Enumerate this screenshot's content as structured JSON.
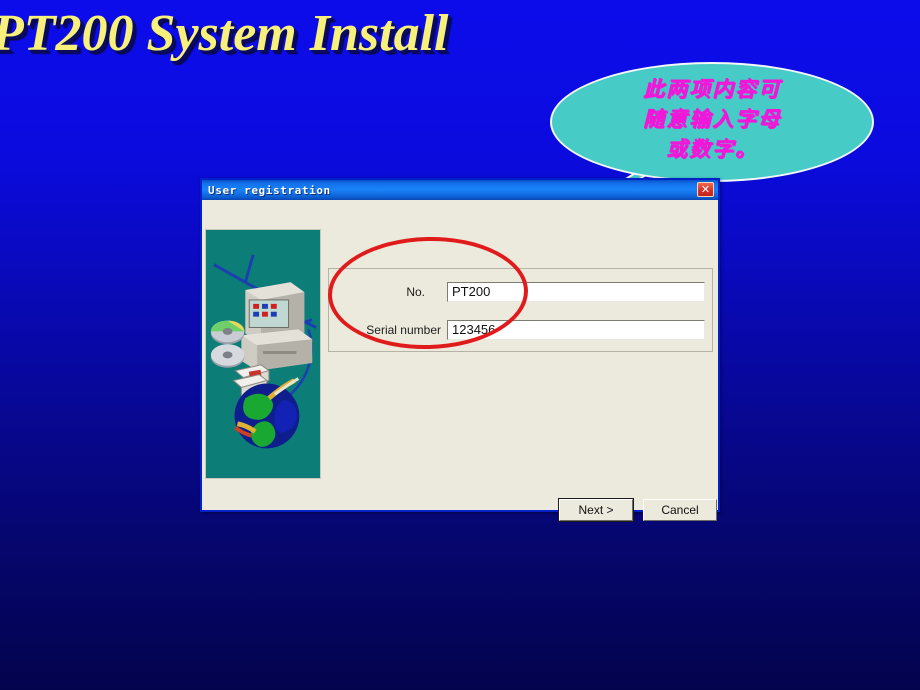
{
  "slide": {
    "title": "PT200 System Install",
    "background_top_color": "#0c0ceb",
    "background_bottom_color": "#03034d",
    "title_color": "#f7f07a"
  },
  "callout": {
    "fill_color": "#46cbc7",
    "text_color": "#f018d8",
    "lines": [
      "此两项内容可",
      "随意输入字母",
      "或数字。"
    ]
  },
  "annotation": {
    "ellipse_color": "#e01b1b"
  },
  "dialog": {
    "title": "User registration",
    "close_icon": "close-icon",
    "close_glyph": "✕",
    "side_graphic": "computer-network-globe-graphic",
    "fields": [
      {
        "label": "No.",
        "value": "PT200",
        "placeholder": ""
      },
      {
        "label": "Serial number",
        "value": "123456",
        "placeholder": ""
      }
    ],
    "buttons": {
      "next": "Next >",
      "cancel": "Cancel"
    }
  }
}
